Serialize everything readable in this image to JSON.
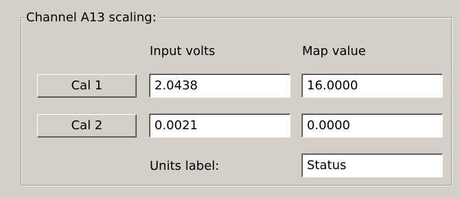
{
  "group": {
    "title": "Channel A13 scaling:"
  },
  "columns": {
    "input_volts": "Input volts",
    "map_value": "Map value"
  },
  "cal1": {
    "button_label": "Cal 1",
    "input_volts": "2.0438",
    "map_value": "16.0000"
  },
  "cal2": {
    "button_label": "Cal 2",
    "input_volts": "0.0021",
    "map_value": "0.0000"
  },
  "units": {
    "label": "Units label:",
    "value": "Status"
  }
}
